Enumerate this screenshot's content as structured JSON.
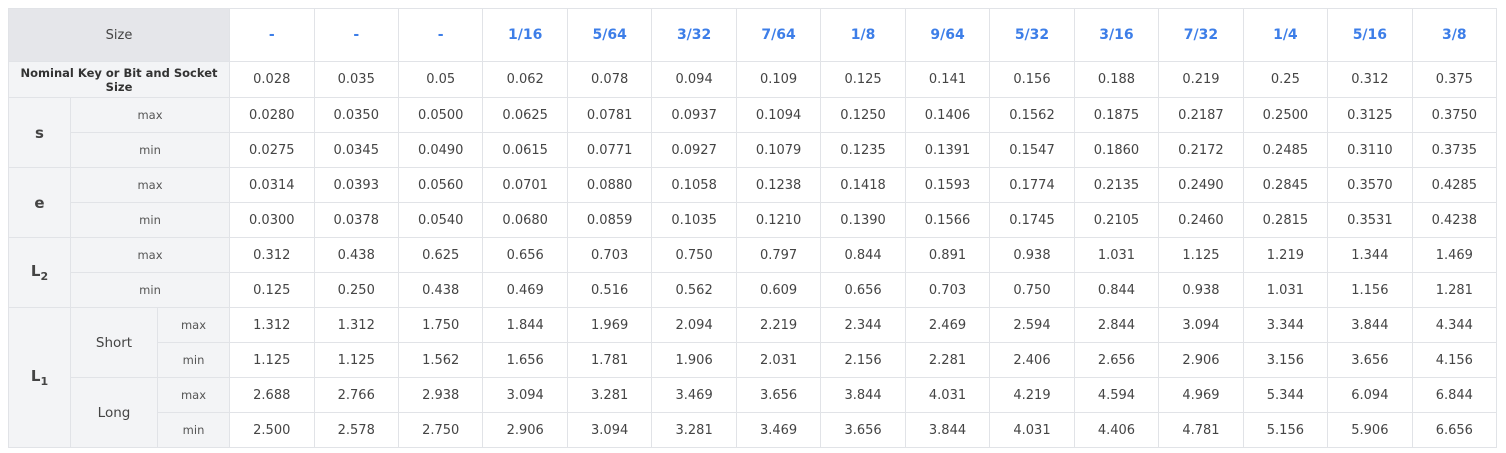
{
  "table": {
    "size_label": "Size",
    "sizes": [
      "-",
      "-",
      "-",
      "1/16",
      "5/64",
      "3/32",
      "7/64",
      "1/8",
      "9/64",
      "5/32",
      "3/16",
      "7/32",
      "1/4",
      "5/16",
      "3/8"
    ],
    "nominal_label": "Nominal Key or Bit and Socket Size",
    "nominal": [
      "0.028",
      "0.035",
      "0.05",
      "0.062",
      "0.078",
      "0.094",
      "0.109",
      "0.125",
      "0.141",
      "0.156",
      "0.188",
      "0.219",
      "0.25",
      "0.312",
      "0.375"
    ],
    "max_label": "max",
    "min_label": "min",
    "s": {
      "label": "s",
      "max": [
        "0.0280",
        "0.0350",
        "0.0500",
        "0.0625",
        "0.0781",
        "0.0937",
        "0.1094",
        "0.1250",
        "0.1406",
        "0.1562",
        "0.1875",
        "0.2187",
        "0.2500",
        "0.3125",
        "0.3750"
      ],
      "min": [
        "0.0275",
        "0.0345",
        "0.0490",
        "0.0615",
        "0.0771",
        "0.0927",
        "0.1079",
        "0.1235",
        "0.1391",
        "0.1547",
        "0.1860",
        "0.2172",
        "0.2485",
        "0.3110",
        "0.3735"
      ]
    },
    "e": {
      "label": "e",
      "max": [
        "0.0314",
        "0.0393",
        "0.0560",
        "0.0701",
        "0.0880",
        "0.1058",
        "0.1238",
        "0.1418",
        "0.1593",
        "0.1774",
        "0.2135",
        "0.2490",
        "0.2845",
        "0.3570",
        "0.4285"
      ],
      "min": [
        "0.0300",
        "0.0378",
        "0.0540",
        "0.0680",
        "0.0859",
        "0.1035",
        "0.1210",
        "0.1390",
        "0.1566",
        "0.1745",
        "0.2105",
        "0.2460",
        "0.2815",
        "0.3531",
        "0.4238"
      ]
    },
    "l2": {
      "label": "L",
      "subscript": "2",
      "max": [
        "0.312",
        "0.438",
        "0.625",
        "0.656",
        "0.703",
        "0.750",
        "0.797",
        "0.844",
        "0.891",
        "0.938",
        "1.031",
        "1.125",
        "1.219",
        "1.344",
        "1.469"
      ],
      "min": [
        "0.125",
        "0.250",
        "0.438",
        "0.469",
        "0.516",
        "0.562",
        "0.609",
        "0.656",
        "0.703",
        "0.750",
        "0.844",
        "0.938",
        "1.031",
        "1.156",
        "1.281"
      ]
    },
    "l1": {
      "label": "L",
      "subscript": "1",
      "short": {
        "label": "Short",
        "max": [
          "1.312",
          "1.312",
          "1.750",
          "1.844",
          "1.969",
          "2.094",
          "2.219",
          "2.344",
          "2.469",
          "2.594",
          "2.844",
          "3.094",
          "3.344",
          "3.844",
          "4.344"
        ],
        "min": [
          "1.125",
          "1.125",
          "1.562",
          "1.656",
          "1.781",
          "1.906",
          "2.031",
          "2.156",
          "2.281",
          "2.406",
          "2.656",
          "2.906",
          "3.156",
          "3.656",
          "4.156"
        ]
      },
      "long": {
        "label": "Long",
        "max": [
          "2.688",
          "2.766",
          "2.938",
          "3.094",
          "3.281",
          "3.469",
          "3.656",
          "3.844",
          "4.031",
          "4.219",
          "4.594",
          "4.969",
          "5.344",
          "6.094",
          "6.844"
        ],
        "min": [
          "2.500",
          "2.578",
          "2.750",
          "2.906",
          "3.094",
          "3.281",
          "3.469",
          "3.656",
          "3.844",
          "4.031",
          "4.406",
          "4.781",
          "5.156",
          "5.906",
          "6.656"
        ]
      }
    },
    "colors": {
      "size_link": "#3d7ee8",
      "label_bg": "#f3f4f6",
      "header_bg": "#e5e6ea",
      "border": "#e1e3e7"
    }
  }
}
